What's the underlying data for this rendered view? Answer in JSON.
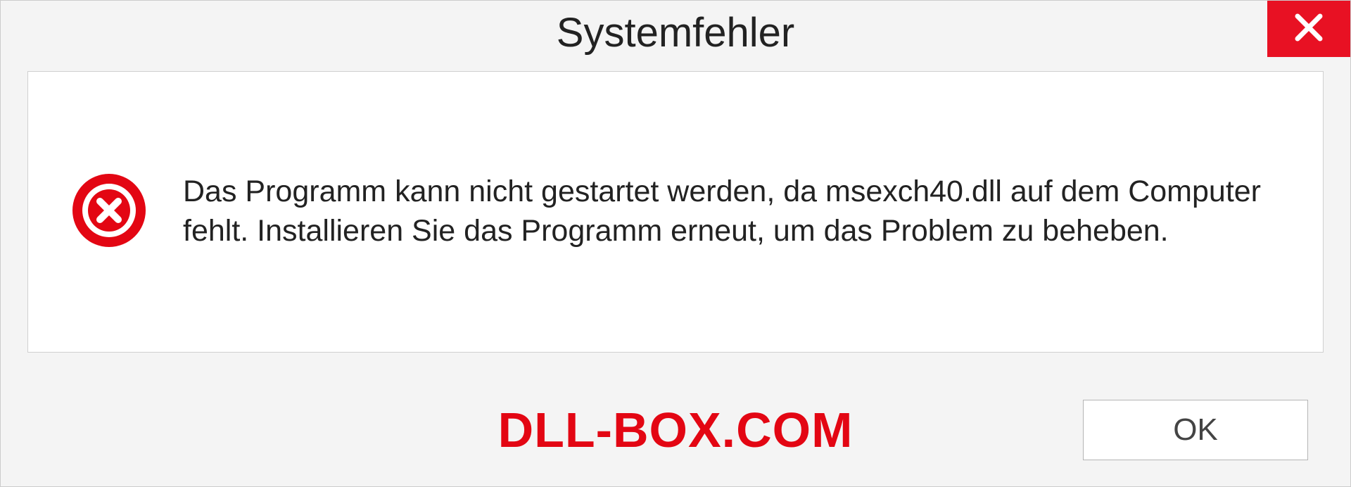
{
  "dialog": {
    "title": "Systemfehler",
    "message": "Das Programm kann nicht gestartet werden, da msexch40.dll auf dem Computer fehlt. Installieren Sie das Programm erneut, um das Problem zu beheben.",
    "ok_label": "OK"
  },
  "watermark": "DLL-BOX.COM"
}
